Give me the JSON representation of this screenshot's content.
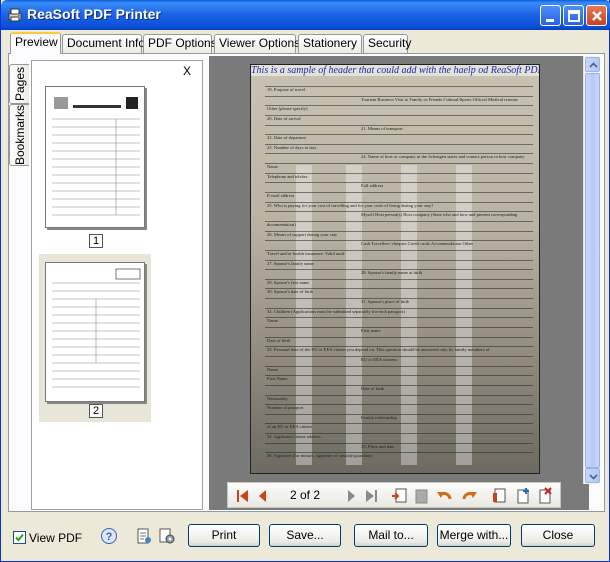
{
  "window": {
    "title": "ReaSoft PDF Printer"
  },
  "tabs": [
    "Preview",
    "Document Info",
    "PDF Options",
    "Viewer Options",
    "Stationery",
    "Security"
  ],
  "side_tabs": {
    "pages": "Pages",
    "bookmarks": "Bookmarks"
  },
  "thumbnails": {
    "close": "X",
    "pages": [
      "1",
      "2"
    ]
  },
  "preview": {
    "header_text": "This is a sample of header that could add with the haelp od ReaSoft PDF printer",
    "form_lines": [
      "19. Purpose of travel",
      "Tourism  Business  Visit to Family or Friends  Cultural/Sports  Official  Medical reasons",
      "Other (please specify)",
      "20. Date of arrival",
      "21. Means of transport",
      "22. Date of departure",
      "23. Number of days at stay",
      "24. Name of host or company in the Schengen states and contact person in host company",
      "Name",
      "Telephone and telefax",
      "Full address",
      "E-mail address",
      "25. Who is paying for your cost of travelling and for your costs of living during your stay?",
      "Myself   Host person(s)   Host company   (State who and how and present corresponding",
      "documentation)",
      "26. Means of support during your stay",
      "Cash   Travellers' cheques   Credit cards   Accommodation   Other",
      "Travel and/or health insurance. Valid until:",
      "27. Spouse's family name",
      "28. Spouse's family name at birth",
      "29. Spouse's first name",
      "30. Spouse's date of birth",
      "31. Spouse's place of birth",
      "32. Children (Applications must be submitted separately for each passport)",
      "Name",
      "First name",
      "Date of birth",
      "33. Personal data of the EU or EEA citizen you depend on. This question should be answered only by family members of",
      "EU or EEA citizens",
      "Name",
      "First Name",
      "Date of birth",
      "Nationality",
      "Number of passport",
      "Family relationship",
      "of an EU or EEA citizen",
      "34. Applicant's home address",
      "35. Place and date",
      "36. Signature (for minors, signature of custody/guardian)"
    ]
  },
  "navigator": {
    "page_indicator": "2 of 2"
  },
  "bottom": {
    "view_pdf_label": "View PDF",
    "view_pdf_checked": true,
    "buttons": [
      "Print",
      "Save...",
      "Mail to...",
      "Merge with...",
      "Close"
    ]
  }
}
